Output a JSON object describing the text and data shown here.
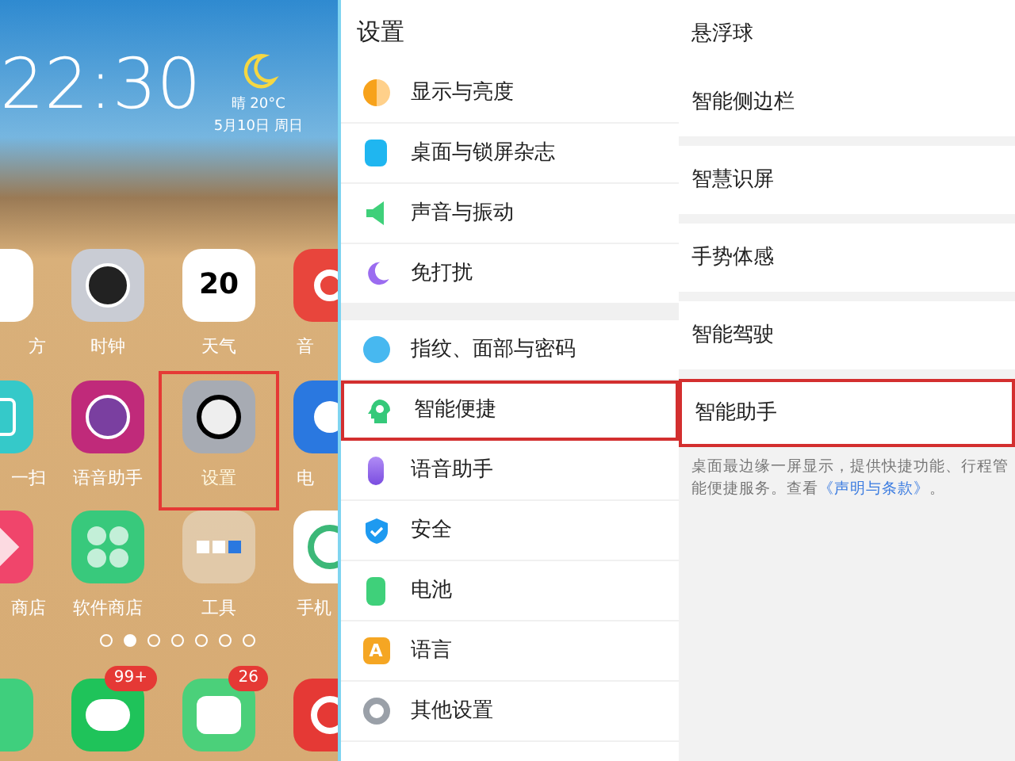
{
  "home_screen": {
    "clock": "22:30",
    "weather": "晴 20°C",
    "date": "5月10日 周日",
    "app_rows": [
      [
        {
          "label": "方",
          "highlighted": false
        },
        {
          "label": "时钟",
          "highlighted": false
        },
        {
          "label": "天气",
          "icon_text": "20",
          "highlighted": false
        },
        {
          "label": "音",
          "highlighted": false
        }
      ],
      [
        {
          "label": "一扫",
          "highlighted": false
        },
        {
          "label": "语音助手",
          "highlighted": false
        },
        {
          "label": "设置",
          "highlighted": true
        },
        {
          "label": "电",
          "highlighted": false
        }
      ],
      [
        {
          "label": "商店",
          "highlighted": false
        },
        {
          "label": "软件商店",
          "highlighted": false
        },
        {
          "label": "工具",
          "highlighted": false
        },
        {
          "label": "手机",
          "highlighted": false
        }
      ]
    ],
    "page_dots": [
      {
        "selected": false
      },
      {
        "selected": true
      },
      {
        "selected": false
      },
      {
        "selected": false
      },
      {
        "selected": false
      },
      {
        "selected": false
      },
      {
        "selected": false
      }
    ],
    "dock_badges": [
      "99+",
      "26"
    ]
  },
  "settings": {
    "title": "设置",
    "groups": [
      [
        {
          "label": "显示与亮度",
          "highlighted": false
        },
        {
          "label": "桌面与锁屏杂志",
          "highlighted": false
        },
        {
          "label": "声音与振动",
          "highlighted": false
        },
        {
          "label": "免打扰",
          "highlighted": false
        }
      ],
      [
        {
          "label": "指纹、面部与密码",
          "highlighted": false
        },
        {
          "label": "智能便捷",
          "highlighted": true
        },
        {
          "label": "语音助手",
          "highlighted": false
        },
        {
          "label": "安全",
          "highlighted": false
        },
        {
          "label": "电池",
          "highlighted": false
        },
        {
          "label": "语言",
          "icon_text": "A",
          "highlighted": false
        },
        {
          "label": "其他设置",
          "highlighted": false
        }
      ]
    ]
  },
  "smart_shortcuts": {
    "groups": [
      [
        {
          "label": "悬浮球",
          "highlighted": false
        },
        {
          "label": "智能侧边栏",
          "highlighted": false
        }
      ],
      [
        {
          "label": "智慧识屏",
          "highlighted": false
        }
      ],
      [
        {
          "label": "手势体感",
          "highlighted": false
        }
      ],
      [
        {
          "label": "智能驾驶",
          "highlighted": false
        }
      ],
      [
        {
          "label": "智能助手",
          "highlighted": true
        }
      ]
    ],
    "note_lines": [
      "桌面最边缘一屏显示，提供快捷功能、行程管",
      "能便捷服务。查看"
    ],
    "note_link": "《声明与条款》",
    "note_end": "。"
  }
}
